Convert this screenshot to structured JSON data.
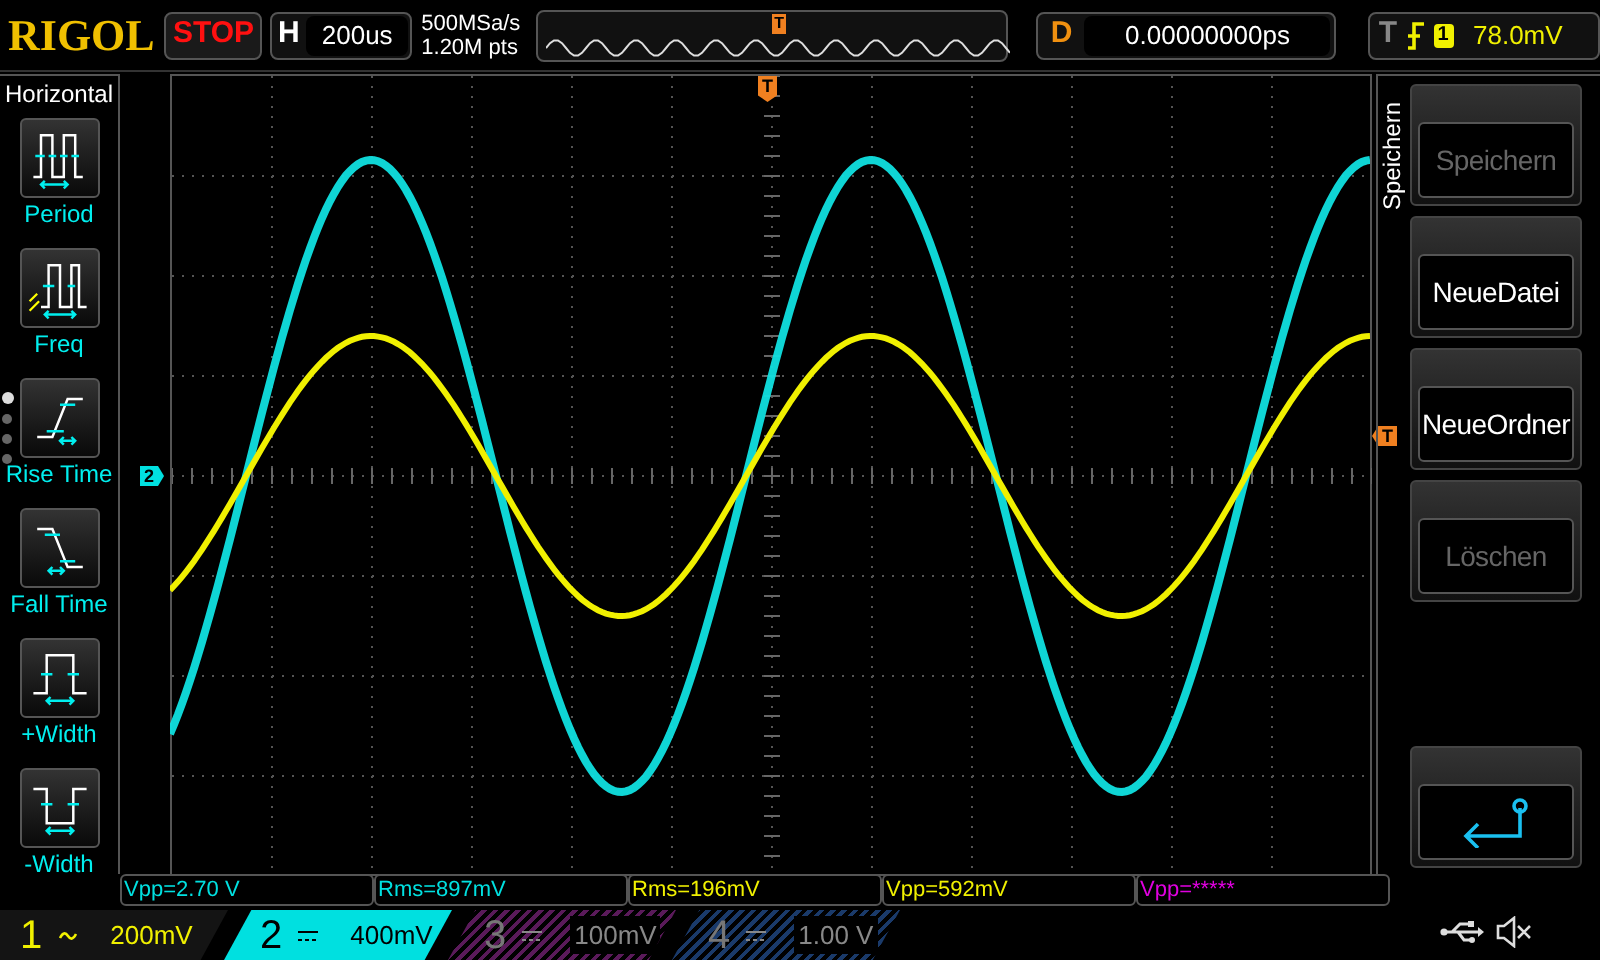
{
  "header": {
    "logo": "RIGOL",
    "run_state": "STOP",
    "timebase": {
      "label": "H",
      "value": "200us"
    },
    "sample_rate": "500MSa/s",
    "memory_depth": "1.20M pts",
    "overview_marker": "T",
    "delay": {
      "label": "D",
      "value": "0.00000000ps"
    },
    "trigger": {
      "label": "T",
      "source": "1",
      "level": "78.0mV"
    }
  },
  "side_menu": {
    "title": "Horizontal",
    "page_dots": [
      {
        "selected": true
      },
      {
        "selected": false
      },
      {
        "selected": false
      },
      {
        "selected": false
      }
    ],
    "items": [
      {
        "kind": "period",
        "label": "Period"
      },
      {
        "kind": "freq",
        "label": "Freq"
      },
      {
        "kind": "rise",
        "label": "Rise Time"
      },
      {
        "kind": "fall",
        "label": "Fall Time"
      },
      {
        "kind": "pwidth",
        "label": "+Width"
      },
      {
        "kind": "nwidth",
        "label": "-Width"
      }
    ]
  },
  "markers": {
    "channel_2": "2",
    "trigger_top": "T",
    "trigger_level": "T"
  },
  "softkeys": {
    "tab": "Speichern",
    "buttons": [
      {
        "kind": "text",
        "label": "Speichern",
        "disabled": true
      },
      {
        "kind": "text",
        "label": "NeueDatei",
        "disabled": false
      },
      {
        "kind": "text",
        "label": "NeueOrdner",
        "disabled": false
      },
      {
        "kind": "text",
        "label": "Löschen",
        "disabled": true
      },
      {
        "kind": "return"
      }
    ]
  },
  "measurements": [
    {
      "text": "Vpp=2.70 V",
      "color": "#00e0e0"
    },
    {
      "text": "Rms=897mV",
      "color": "#00e0e0"
    },
    {
      "text": "Rms=196mV",
      "color": "#f0f000"
    },
    {
      "text": "Vpp=592mV",
      "color": "#f0f000"
    },
    {
      "text": "Vpp=*****",
      "color": "#e000e0"
    }
  ],
  "channels": [
    {
      "number": "1",
      "kind": "ac",
      "scale": "200mV",
      "enabled": true,
      "selected": false,
      "color": "#f0f000"
    },
    {
      "number": "2",
      "kind": "dc",
      "scale": "400mV",
      "enabled": true,
      "selected": true,
      "color": "#00e0e0"
    },
    {
      "number": "3",
      "kind": "dc",
      "scale": "100mV",
      "enabled": false,
      "selected": false,
      "color": "#5a1a5a"
    },
    {
      "number": "4",
      "kind": "dc",
      "scale": "1.00 V",
      "enabled": false,
      "selected": false,
      "color": "#1a3a6a"
    }
  ]
}
